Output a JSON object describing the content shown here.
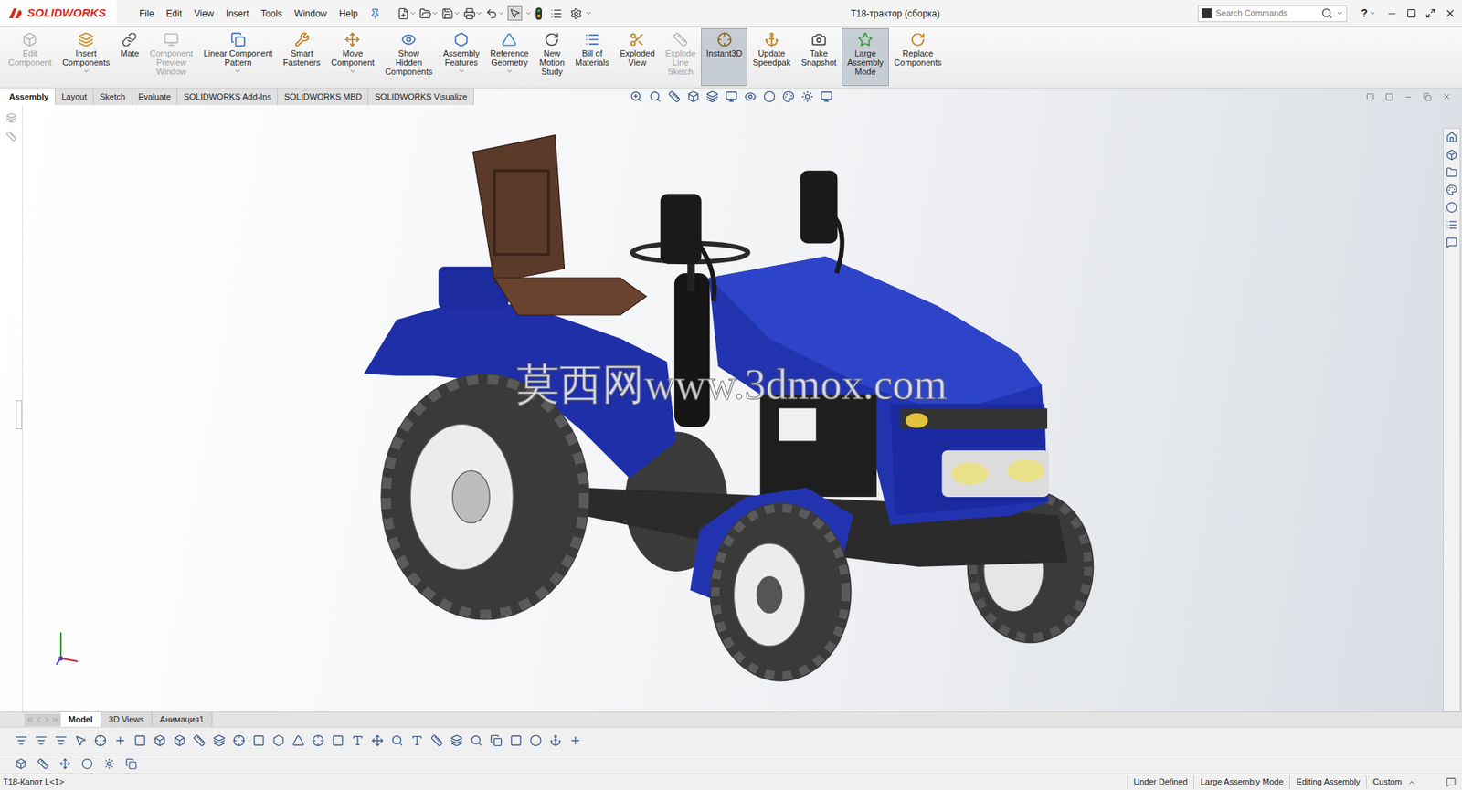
{
  "app": {
    "logo": "SOLIDWORKS"
  },
  "menu": [
    "File",
    "Edit",
    "View",
    "Insert",
    "Tools",
    "Window",
    "Help"
  ],
  "window": {
    "title": "T18-трактор (сборка)"
  },
  "search": {
    "placeholder": "Search Commands"
  },
  "help": "?",
  "ribbon": [
    {
      "lines": [
        "Edit",
        "Component"
      ],
      "disabled": true,
      "selected": false,
      "dropdown": false
    },
    {
      "lines": [
        "Insert",
        "Components"
      ],
      "disabled": false,
      "selected": false,
      "dropdown": true
    },
    {
      "lines": [
        "Mate"
      ],
      "disabled": false,
      "selected": false,
      "dropdown": false
    },
    {
      "lines": [
        "Component",
        "Preview",
        "Window"
      ],
      "disabled": true,
      "selected": false,
      "dropdown": false
    },
    {
      "lines": [
        "Linear Component",
        "Pattern"
      ],
      "disabled": false,
      "selected": false,
      "dropdown": true
    },
    {
      "lines": [
        "Smart",
        "Fasteners"
      ],
      "disabled": false,
      "selected": false,
      "dropdown": false
    },
    {
      "lines": [
        "Move",
        "Component"
      ],
      "disabled": false,
      "selected": false,
      "dropdown": true
    },
    {
      "lines": [
        "Show",
        "Hidden",
        "Components"
      ],
      "disabled": false,
      "selected": false,
      "dropdown": false
    },
    {
      "lines": [
        "Assembly",
        "Features"
      ],
      "disabled": false,
      "selected": false,
      "dropdown": true
    },
    {
      "lines": [
        "Reference",
        "Geometry"
      ],
      "disabled": false,
      "selected": false,
      "dropdown": true
    },
    {
      "lines": [
        "New",
        "Motion",
        "Study"
      ],
      "disabled": false,
      "selected": false,
      "dropdown": false
    },
    {
      "lines": [
        "Bill of",
        "Materials"
      ],
      "disabled": false,
      "selected": false,
      "dropdown": false
    },
    {
      "lines": [
        "Exploded",
        "View"
      ],
      "disabled": false,
      "selected": false,
      "dropdown": false
    },
    {
      "lines": [
        "Explode",
        "Line",
        "Sketch"
      ],
      "disabled": true,
      "selected": false,
      "dropdown": false
    },
    {
      "lines": [
        "Instant3D"
      ],
      "disabled": false,
      "selected": true,
      "dropdown": false
    },
    {
      "lines": [
        "Update",
        "Speedpak"
      ],
      "disabled": false,
      "selected": false,
      "dropdown": false
    },
    {
      "lines": [
        "Take",
        "Snapshot"
      ],
      "disabled": false,
      "selected": false,
      "dropdown": false
    },
    {
      "lines": [
        "Large",
        "Assembly",
        "Mode"
      ],
      "disabled": false,
      "selected": true,
      "dropdown": false
    },
    {
      "lines": [
        "Replace",
        "Components"
      ],
      "disabled": false,
      "selected": false,
      "dropdown": false
    }
  ],
  "tabs": [
    {
      "label": "Assembly",
      "selected": true
    },
    {
      "label": "Layout",
      "selected": false
    },
    {
      "label": "Sketch",
      "selected": false
    },
    {
      "label": "Evaluate",
      "selected": false
    },
    {
      "label": "SOLIDWORKS Add-Ins",
      "selected": false
    },
    {
      "label": "SOLIDWORKS MBD",
      "selected": false
    },
    {
      "label": "SOLIDWORKS Visualize",
      "selected": false
    }
  ],
  "watermark": "莫西网www.3dmox.com",
  "bottom_tabs": [
    {
      "label": "Model",
      "selected": true
    },
    {
      "label": "3D Views",
      "selected": false
    },
    {
      "label": "Анимация1",
      "selected": false
    }
  ],
  "status_bar": {
    "component": "T18-Капот L<1>",
    "items": [
      "Under Defined",
      "Large Assembly Mode",
      "Editing Assembly",
      "Custom"
    ]
  }
}
